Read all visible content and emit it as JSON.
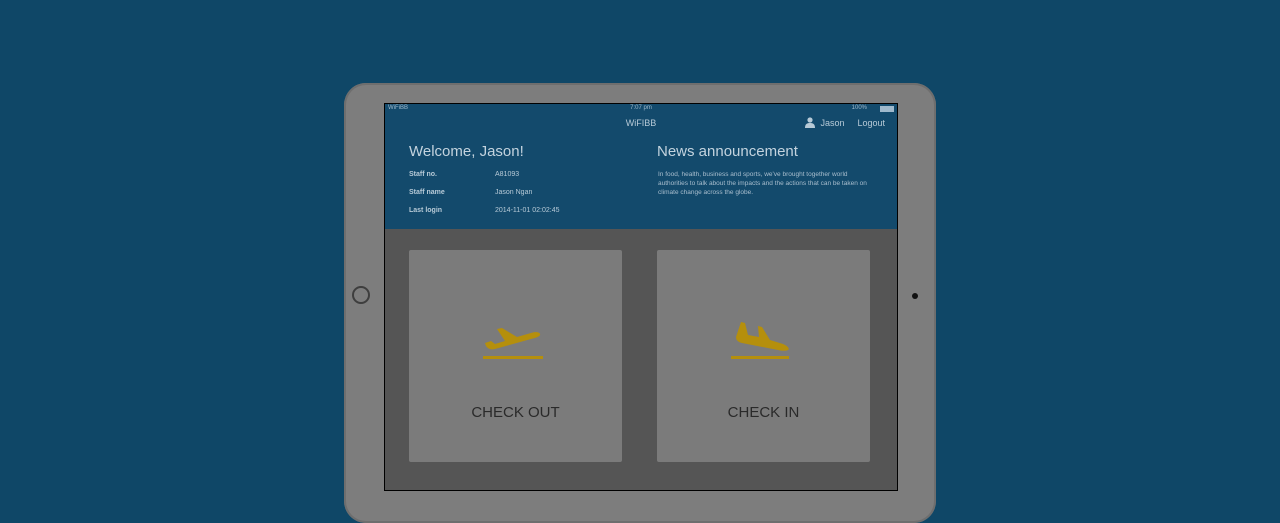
{
  "status_bar": {
    "carrier": "WiFiBB",
    "time": "7:07 pm",
    "battery": "100%"
  },
  "header": {
    "app_title": "WiFIBB",
    "user_name": "Jason",
    "logout_label": "Logout",
    "user_icon": "user-icon"
  },
  "welcome": {
    "title": "Welcome, Jason!",
    "rows": [
      {
        "label": "Staff no.",
        "value": "A81093"
      },
      {
        "label": "Staff name",
        "value": "Jason Ngan"
      },
      {
        "label": "Last login",
        "value": "2014-11-01 02:02:45"
      }
    ]
  },
  "news": {
    "title": "News announcement",
    "body": "In food, health, business and sports, we've brought together world authorities to talk about the impacts and the actions that can be taken on climate change across the globe."
  },
  "actions": [
    {
      "label": "CHECK OUT",
      "icon": "airplane-departure-icon"
    },
    {
      "label": "CHECK IN",
      "icon": "airplane-arrival-icon"
    }
  ],
  "colors": {
    "background": "#0f4767",
    "header": "#134a6c",
    "card": "#7b7b7b",
    "icon_accent": "#b58f0c"
  }
}
